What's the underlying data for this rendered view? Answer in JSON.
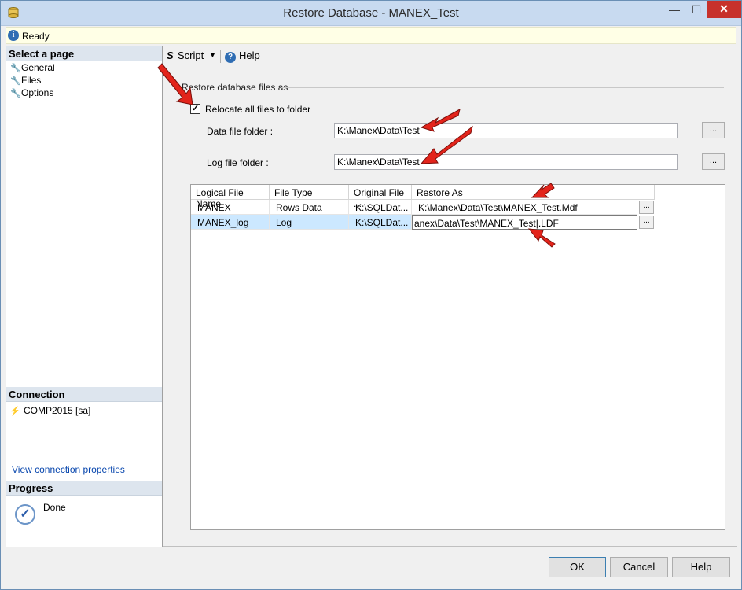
{
  "window": {
    "title": "Restore Database - MANEX_Test",
    "controls": {
      "minimize": "—",
      "maximize": "☐",
      "close": "✕"
    }
  },
  "status": {
    "text": "Ready",
    "icon": "info-icon"
  },
  "left_pane": {
    "select_page_header": "Select a page",
    "pages": [
      {
        "label": "General",
        "icon": "wrench-icon"
      },
      {
        "label": "Files",
        "icon": "wrench-icon"
      },
      {
        "label": "Options",
        "icon": "wrench-icon"
      }
    ],
    "connection_header": "Connection",
    "connection_value": "COMP2015 [sa]",
    "view_connection_link": "View connection properties",
    "progress_header": "Progress",
    "progress_value": "Done"
  },
  "toolbar": {
    "script_label": "Script",
    "help_label": "Help"
  },
  "restore_section": {
    "label": "Restore database files as",
    "relocate_checked": true,
    "relocate_label": "Relocate all files to folder",
    "data_folder_label": "Data file folder :",
    "data_folder_value": "K:\\Manex\\Data\\Test",
    "log_folder_label": "Log file folder :",
    "log_folder_value": "K:\\Manex\\Data\\Test",
    "browse_label": "..."
  },
  "grid": {
    "columns": [
      "Logical File Name",
      "File Type",
      "Original File ...",
      "Restore As"
    ],
    "rows": [
      {
        "logical": "MANEX",
        "type": "Rows Data",
        "original": "K:\\SQLDat...",
        "restore_as": "K:\\Manex\\Data\\Test\\MANEX_Test.Mdf"
      },
      {
        "logical": "MANEX_log",
        "type": "Log",
        "original": "K:\\SQLDat...",
        "restore_as": "anex\\Data\\Test\\MANEX_Test|.LDF"
      }
    ],
    "cell_button_label": "..."
  },
  "buttons": {
    "ok": "OK",
    "cancel": "Cancel",
    "help": "Help"
  },
  "colors": {
    "arrow": "#e3241b",
    "selection": "#cce8ff",
    "close_button": "#c7312b"
  }
}
